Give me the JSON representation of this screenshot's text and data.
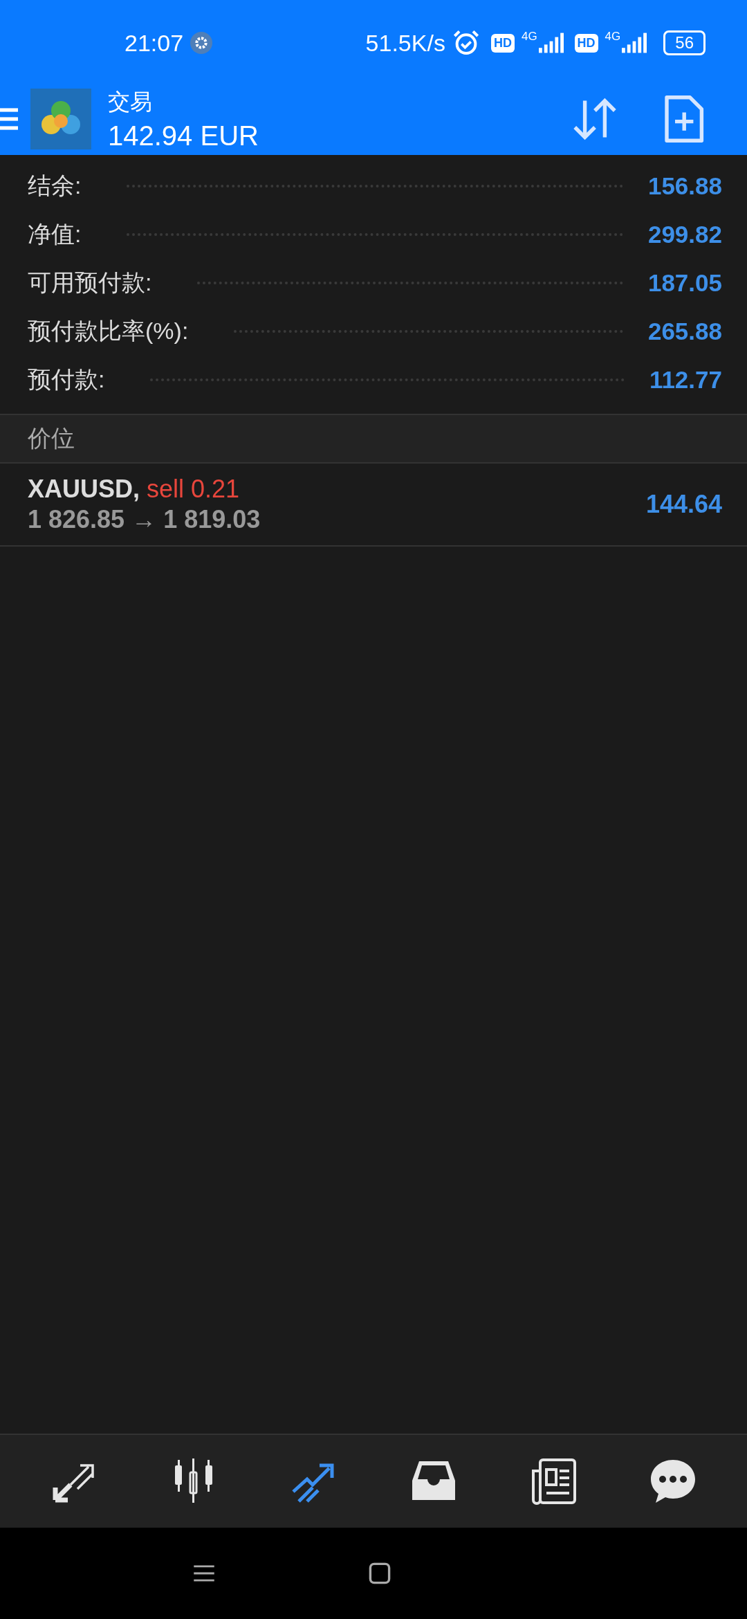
{
  "status_bar": {
    "time": "21:07",
    "speed": "51.5K/s",
    "sims": [
      {
        "hd": "HD",
        "network": "4G"
      },
      {
        "hd": "HD",
        "network": "4G"
      }
    ],
    "battery": "56"
  },
  "header": {
    "title": "交易",
    "balance": "142.94 EUR"
  },
  "summary": [
    {
      "label": "结余:",
      "value": "156.88"
    },
    {
      "label": "净值:",
      "value": "299.82"
    },
    {
      "label": "可用预付款:",
      "value": "187.05"
    },
    {
      "label": "预付款比率(%):",
      "value": "265.88"
    },
    {
      "label": "预付款:",
      "value": "112.77"
    }
  ],
  "section": {
    "title": "价位"
  },
  "positions": [
    {
      "symbol": "XAUUSD,",
      "side": "sell 0.21",
      "prices": "1 826.85 → 1 819.03",
      "profit": "144.64"
    }
  ],
  "nav": [
    {
      "kind": "trade",
      "selected": false
    },
    {
      "kind": "quotes",
      "selected": false
    },
    {
      "kind": "chart",
      "selected": true
    },
    {
      "kind": "inbox",
      "selected": false
    },
    {
      "kind": "news",
      "selected": false
    },
    {
      "kind": "chat",
      "selected": false
    }
  ]
}
